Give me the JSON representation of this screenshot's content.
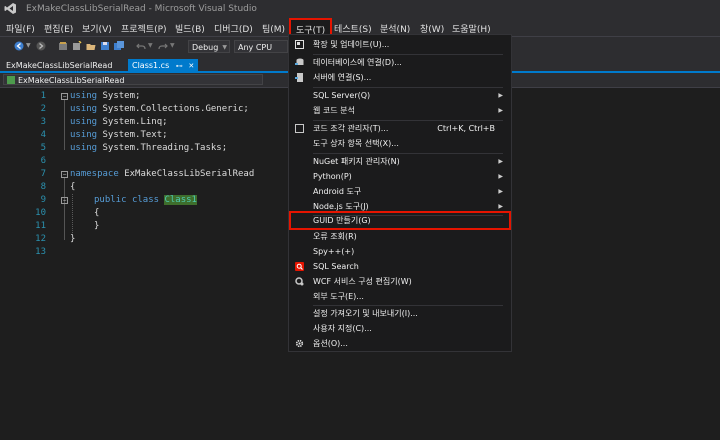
{
  "window": {
    "title": "ExMakeClassLibSerialRead - Microsoft Visual Studio"
  },
  "menu": [
    {
      "label": "파일(F)",
      "active": false
    },
    {
      "label": "편집(E)",
      "active": false
    },
    {
      "label": "보기(V)",
      "active": false
    },
    {
      "label": "프로젝트(P)",
      "active": false
    },
    {
      "label": "빌드(B)",
      "active": false
    },
    {
      "label": "디버그(D)",
      "active": false
    },
    {
      "label": "팀(M)",
      "active": false
    },
    {
      "label": "도구(T)",
      "active": true
    },
    {
      "label": "테스트(S)",
      "active": false
    },
    {
      "label": "분석(N)",
      "active": false
    },
    {
      "label": "창(W)",
      "active": false
    },
    {
      "label": "도움말(H)",
      "active": false
    }
  ],
  "toolbar": {
    "config": "Debug",
    "platform": "Any CPU"
  },
  "tabs": [
    {
      "label": "ExMakeClassLibSerialRead",
      "active": false
    },
    {
      "label": "Class1.cs",
      "active": true,
      "pin": "⊷",
      "close": "✕"
    }
  ],
  "navbar": {
    "project": "ExMakeClassLibSerialRead"
  },
  "editor": {
    "line_numbers": [
      "1",
      "2",
      "3",
      "4",
      "5",
      "6",
      "7",
      "8",
      "9",
      "10",
      "11",
      "12",
      "13"
    ],
    "lines": {
      "l1_kw": "using",
      "l1_rest": " System;",
      "l2_kw": "using",
      "l2_rest": " System.Collections.Generic;",
      "l3_kw": "using",
      "l3_rest": " System.Linq;",
      "l4_kw": "using",
      "l4_rest": " System.Text;",
      "l5_kw": "using",
      "l5_rest": " System.Threading.Tasks;",
      "l7_kw": "namespace",
      "l7_rest": " ExMakeClassLibSerialRead",
      "l8": "{",
      "l9_kw1": "public",
      "l9_kw2": "class",
      "l9_type": "Class1",
      "l10": "{",
      "l11": "}",
      "l12": "}"
    }
  },
  "tools_menu": {
    "items": [
      {
        "label": "확장 및 업데이트(U)...",
        "icon": "extensions-icon"
      },
      {
        "label": "데이터베이스에 연결(D)...",
        "icon": "database-connect-icon"
      },
      {
        "label": "서버에 연결(S)...",
        "icon": "server-connect-icon"
      },
      {
        "label": "SQL Server(Q)",
        "submenu": true
      },
      {
        "label": "웹 코드 분석",
        "submenu": true
      },
      {
        "label": "코드 조각 관리자(T)...",
        "shortcut": "Ctrl+K, Ctrl+B",
        "icon": "checkbox-icon"
      },
      {
        "label": "도구 상자 항목 선택(X)..."
      },
      {
        "label": "NuGet 패키지 관리자(N)",
        "submenu": true
      },
      {
        "label": "Python(P)",
        "submenu": true
      },
      {
        "label": "Android 도구",
        "submenu": true
      },
      {
        "label": "Node.js 도구(J)",
        "submenu": true
      },
      {
        "label": "GUID 만들기(G)",
        "highlighted": true
      },
      {
        "label": "오류 조회(R)"
      },
      {
        "label": "Spy++(+)"
      },
      {
        "label": "SQL Search",
        "icon": "sql-search-icon"
      },
      {
        "label": "WCF 서비스 구성 편집기(W)",
        "icon": "wcf-config-icon"
      },
      {
        "label": "외부 도구(E)..."
      },
      {
        "label": "설정 가져오기 및 내보내기(I)..."
      },
      {
        "label": "사용자 지정(C)..."
      },
      {
        "label": "옵션(O)...",
        "icon": "gear-icon"
      }
    ],
    "submenu_arrow": "▶"
  },
  "colors": {
    "accent": "#007acc",
    "highlight_box": "#e51400",
    "keyword": "#569cd6",
    "type": "#4ec9b0",
    "line_number": "#2b91af"
  }
}
